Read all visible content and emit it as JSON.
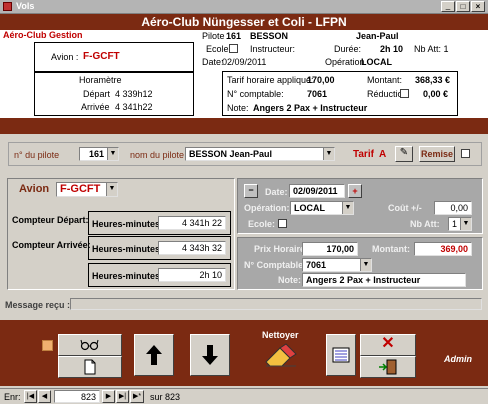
{
  "window": {
    "title": "Vols"
  },
  "header": {
    "title": "Aéro-Club Nüngesser et Coli - LFPN",
    "subtitle": "Aéro-Club Gestion"
  },
  "summary": {
    "avion_label": "Avion :",
    "avion_value": "F-GCFT",
    "horametre_label": "Horamètre",
    "depart_label": "Départ",
    "depart_value": "4 339h12",
    "arrivee_label": "Arrivée",
    "arrivee_value": "4 341h22",
    "pilote_label": "Pilote",
    "pilote_num": "161",
    "pilote_nom": "BESSON",
    "pilote_prenom": "Jean-Paul",
    "ecole_label": "Ecole:",
    "instructeur_label": "Instructeur:",
    "duree_label": "Durée:",
    "duree_value": "2h 10",
    "nbatt_label": "Nb Att: 1",
    "date_label": "Date:",
    "date_value": "02/09/2011",
    "operation_label": "Opération",
    "operation_value": "LOCAL",
    "tarif_label": "Tarif horaire appliqué:",
    "tarif_value": "170,00",
    "montant_label": "Montant:",
    "montant_value": "368,33 €",
    "comptable_label": "N° comptable:",
    "comptable_value": "7061",
    "reduction_label": "Réduction",
    "reduction_value": "0,00 €",
    "note_label": "Note:",
    "note_value": "Angers 2 Pax + Instructeur"
  },
  "pilot_bar": {
    "num_label": "n° du pilote",
    "num_value": "161",
    "nom_label": "nom du pilote",
    "nom_value": "BESSON Jean-Paul",
    "tarif_label": "Tarif",
    "tarif_value": "A",
    "remise_label": "Remise"
  },
  "left_panel": {
    "avion_label": "Avion",
    "avion_value": "F-GCFT",
    "compteur_depart_label": "Compteur Départ:",
    "compteur_arrivee_label": "Compteur Arrivée:",
    "hm_label": "Heures-minutes",
    "depart_value": "4 341h 22",
    "arrivee_value": "4 343h 32",
    "duree_value": "2h 10"
  },
  "right_panel": {
    "minus": "−",
    "date_label": "Date:",
    "date_value": "02/09/2011",
    "plus": "+",
    "operation_label": "Opération:",
    "operation_value": "LOCAL",
    "cout_label": "Coût +/-",
    "cout_value": "0,00",
    "ecole_label": "Ecole:",
    "nbatt_label": "Nb Att:",
    "nbatt_value": "1"
  },
  "tarif_panel": {
    "prix_label": "Prix Horaire:",
    "prix_value": "170,00",
    "montant_label": "Montant:",
    "montant_value": "369,00",
    "comptable_label": "N° Comptable:",
    "comptable_value": "7061",
    "note_label": "Note:",
    "note_value": "Angers 2 Pax + Instructeur"
  },
  "message": {
    "label": "Message reçu :",
    "value": ""
  },
  "toolbar": {
    "nettoyer_label": "Nettoyer",
    "admin_label": "Admin"
  },
  "nav": {
    "enr_label": "Enr:",
    "current": "823",
    "sur_label": "sur",
    "total": "823"
  },
  "colors": {
    "maroon": "#7b2a12",
    "montant_red": "#c00000"
  }
}
